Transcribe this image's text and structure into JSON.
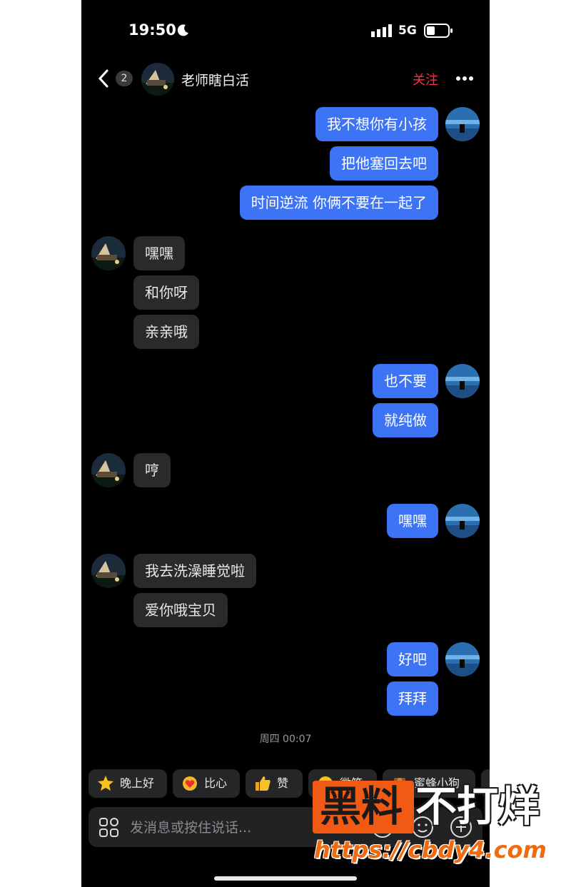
{
  "status_bar": {
    "time": "19:50",
    "network": "5G"
  },
  "header": {
    "unread_count": "2",
    "contact_name": "老师瞎白活",
    "follow_label": "关注"
  },
  "messages": [
    {
      "side": "out",
      "text": "我不想你有小孩"
    },
    {
      "side": "out",
      "text": "把他塞回去吧"
    },
    {
      "side": "out",
      "text": "时间逆流 你俩不要在一起了"
    },
    {
      "side": "in",
      "text": "嘿嘿"
    },
    {
      "side": "in",
      "text": "和你呀"
    },
    {
      "side": "in",
      "text": "亲亲哦"
    },
    {
      "side": "out",
      "text": "也不要"
    },
    {
      "side": "out",
      "text": "就纯做"
    },
    {
      "side": "in",
      "text": "哼"
    },
    {
      "side": "out",
      "text": "嘿嘿"
    },
    {
      "side": "in",
      "text": "我去洗澡睡觉啦"
    },
    {
      "side": "in",
      "text": "爱你哦宝贝"
    },
    {
      "side": "out",
      "text": "好吧"
    },
    {
      "side": "out",
      "text": "拜拜"
    }
  ],
  "timestamp": "周四 00:07",
  "quick_replies": [
    {
      "label": "晚上好",
      "icon": "star-face-icon"
    },
    {
      "label": "比心",
      "icon": "heart-hands-icon"
    },
    {
      "label": "赞",
      "icon": "thumbs-up-icon"
    },
    {
      "label": "微笑",
      "icon": "smile-icon"
    },
    {
      "label": "蜜蜂小狗",
      "icon": "bee-dog-icon"
    }
  ],
  "input": {
    "placeholder": "发消息或按住说话..."
  },
  "watermark": {
    "title_a": "黑料",
    "title_b": "不打烊",
    "url": "https://cbdy4.com"
  },
  "colors": {
    "outgoing_bubble": "#3d73f5",
    "incoming_bubble": "#2a2a2c",
    "follow": "#ff2f4a",
    "watermark": "#f05a14"
  }
}
